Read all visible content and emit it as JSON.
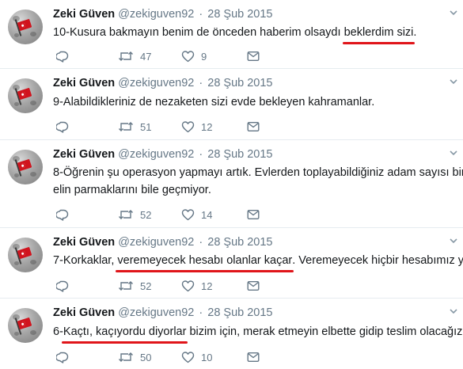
{
  "tweets": [
    {
      "name": "Zeki Güven",
      "handle": "@zekiguven92",
      "separator": "·",
      "date": "28 Şub 2015",
      "text_parts": [
        "10-Kusura bakmayın benim de önceden haberim olsaydı ",
        "beklerdim sizi",
        "."
      ],
      "retweets": "47",
      "likes": "9"
    },
    {
      "name": "Zeki Güven",
      "handle": "@zekiguven92",
      "separator": "·",
      "date": "28 Şub 2015",
      "text_parts": [
        "9-Alabildikleriniz de nezaketen sizi evde bekleyen kahramanlar."
      ],
      "retweets": "51",
      "likes": "12"
    },
    {
      "name": "Zeki Güven",
      "handle": "@zekiguven92",
      "separator": "·",
      "date": "28 Şub 2015",
      "text_line1": "8-Öğrenin şu operasyon yapmayı artık. Evlerden toplayabildiğiniz adam sayısı bir",
      "text_line2": "elin parmaklarını bile geçmiyor.",
      "retweets": "52",
      "likes": "14"
    },
    {
      "name": "Zeki Güven",
      "handle": "@zekiguven92",
      "separator": "·",
      "date": "28 Şub 2015",
      "text_parts": [
        "7-Korkaklar, ",
        "veremeyecek hesabı olanlar kaçar",
        ". Veremeyecek hiçbir hesabımız yok."
      ],
      "retweets": "52",
      "likes": "12"
    },
    {
      "name": "Zeki Güven",
      "handle": "@zekiguven92",
      "separator": "·",
      "date": "28 Şub 2015",
      "text_parts": [
        "6-",
        "Kaçtı, kaçıyordu diyorlar",
        " bizim için, merak etmeyin elbette gidip teslim olacağız."
      ],
      "retweets": "50",
      "likes": "10"
    }
  ],
  "colors": {
    "name": "#14171a",
    "muted": "#657786",
    "divider": "#e6ecf0",
    "underline": "#e0151a",
    "flag": "#d0141e"
  },
  "icons": [
    "reply-icon",
    "retweet-icon",
    "like-icon",
    "direct-message-icon",
    "chevron-down-icon"
  ]
}
